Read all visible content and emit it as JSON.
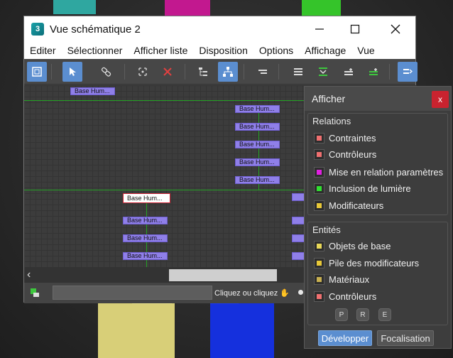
{
  "window": {
    "title": "Vue schématique 2",
    "app_icon_text": "3"
  },
  "menu": {
    "items": [
      {
        "label": "Editer"
      },
      {
        "label": "Sélectionner"
      },
      {
        "label": "Afficher liste"
      },
      {
        "label": "Disposition"
      },
      {
        "label": "Options"
      },
      {
        "label": "Affichage"
      },
      {
        "label": "Vue"
      }
    ]
  },
  "toolbar": {
    "icons": [
      "display-floater-icon",
      "select-arrow-icon",
      "connect-icon",
      "unlink-selected-icon",
      "delete-icon",
      "hierarchy-mode-icon",
      "references-mode-icon",
      "always-arrange-icon",
      "arrange-children-icon",
      "arrange-selected-icon",
      "free-all-icon",
      "free-selected-icon",
      "expand-selected-icon"
    ]
  },
  "schematic": {
    "node_label": "Base Hum...",
    "selected_node_label": "Base Hum..."
  },
  "statusbar": {
    "text": "Cliquez ou cliquez"
  },
  "panel": {
    "title": "Afficher",
    "close_label": "x",
    "relations": {
      "label": "Relations",
      "items": [
        {
          "label": "Contraintes",
          "color": "#f07070"
        },
        {
          "label": "Contrôleurs",
          "color": "#f07070"
        },
        {
          "label": "Mise en relation paramètres",
          "color": "#e020e0"
        },
        {
          "label": "Inclusion de lumière",
          "color": "#30e030"
        },
        {
          "label": "Modificateurs",
          "color": "#e8c838"
        }
      ]
    },
    "entities": {
      "label": "Entités",
      "items": [
        {
          "label": "Objets de base",
          "color": "#e8d858"
        },
        {
          "label": "Pile des modificateurs",
          "color": "#e8c838"
        },
        {
          "label": "Matériaux",
          "color": "#c8b050"
        },
        {
          "label": "Contrôleurs",
          "color": "#f07070"
        }
      ]
    },
    "pre_buttons": [
      "P",
      "R",
      "E"
    ],
    "expand_label": "Développer",
    "focus_label": "Focalisation"
  }
}
